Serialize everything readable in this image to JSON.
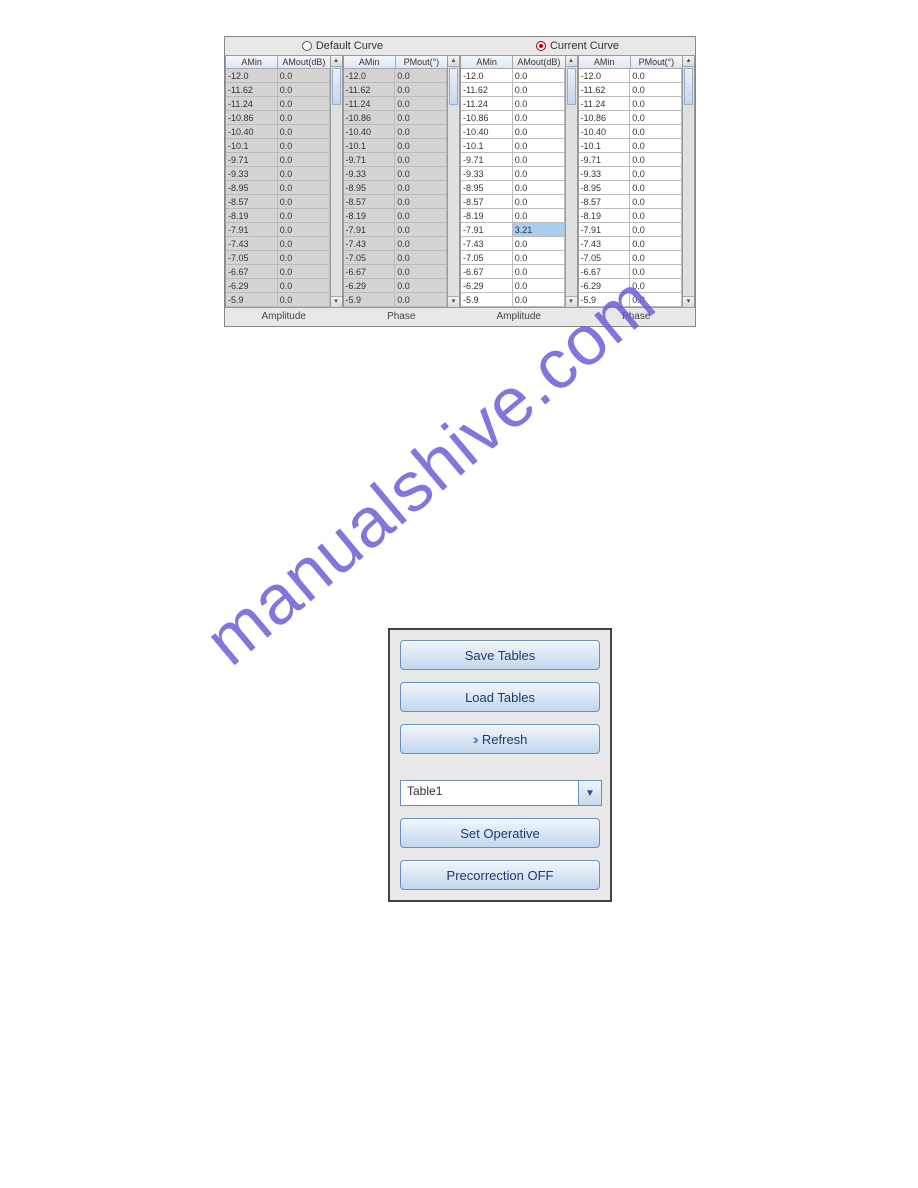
{
  "radios": {
    "default_label": "Default Curve",
    "current_label": "Current Curve"
  },
  "headers": {
    "amin": "AMin",
    "amout": "AMout(dB)",
    "pmout": "PMout(°)"
  },
  "table_labels": {
    "amplitude": "Amplitude",
    "phase": "Phase"
  },
  "amin_values": [
    "-12.0",
    "-11.62",
    "-11.24",
    "-10.86",
    "-10.40",
    "-10.1",
    "-9.71",
    "-9.33",
    "-8.95",
    "-8.57",
    "-8.19",
    "-7.91",
    "-7.43",
    "-7.05",
    "-6.67",
    "-6.29",
    "-5.9"
  ],
  "tables": {
    "default_amp": [
      "0.0",
      "0.0",
      "0.0",
      "0.0",
      "0.0",
      "0.0",
      "0.0",
      "0.0",
      "0.0",
      "0.0",
      "0.0",
      "0.0",
      "0.0",
      "0.0",
      "0.0",
      "0.0",
      "0.0"
    ],
    "default_phase": [
      "0.0",
      "0.0",
      "0.0",
      "0.0",
      "0.0",
      "0.0",
      "0.0",
      "0.0",
      "0.0",
      "0.0",
      "0.0",
      "0.0",
      "0.0",
      "0.0",
      "0.0",
      "0.0",
      "0.0"
    ],
    "current_amp": [
      "0.0",
      "0.0",
      "0.0",
      "0.0",
      "0.0",
      "0.0",
      "0.0",
      "0.0",
      "0.0",
      "0.0",
      "0.0",
      "3.21",
      "0.0",
      "0.0",
      "0.0",
      "0.0",
      "0.0"
    ],
    "current_phase": [
      "0.0",
      "0.0",
      "0.0",
      "0.0",
      "0.0",
      "0.0",
      "0.0",
      "0.0",
      "0.0",
      "0.0",
      "0.0",
      "0.0",
      "0.0",
      "0.0",
      "0.0",
      "0.0",
      "0.0"
    ]
  },
  "highlight_row": 11,
  "controls": {
    "save": "Save Tables",
    "load": "Load Tables",
    "refresh": "Refresh",
    "dropdown": "Table1",
    "set_operative": "Set Operative",
    "precorrection": "Precorrection OFF"
  },
  "watermark": "manualshive.com"
}
